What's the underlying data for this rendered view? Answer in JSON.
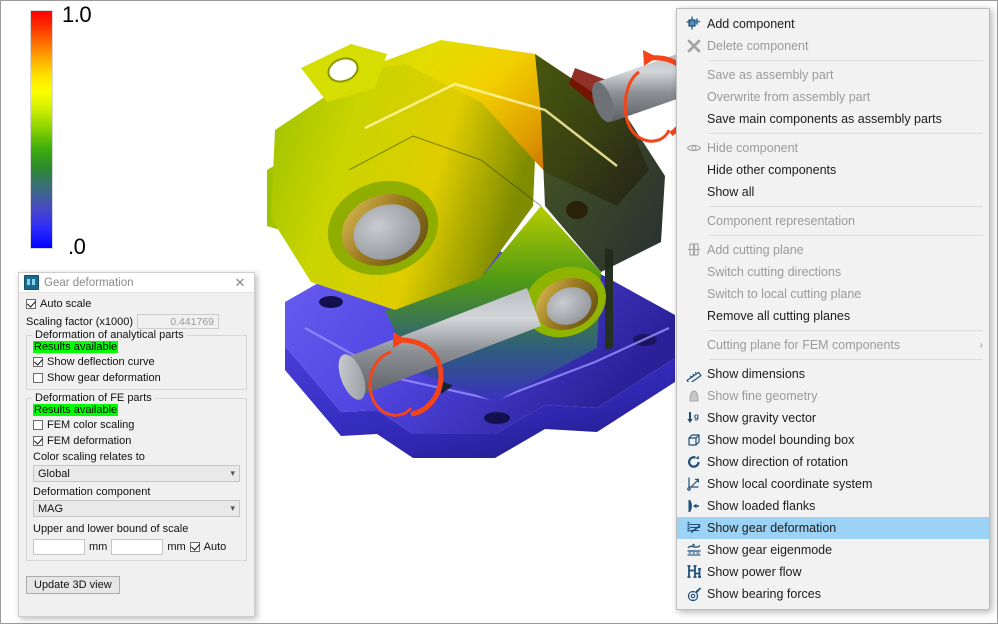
{
  "legend": {
    "max_label": "1.0",
    "min_label": ".0",
    "top_color": "#ff0000",
    "bottom_color": "#0000ff"
  },
  "model": {
    "description": "3D gearbox housing with FEM deformation colour map",
    "rotation_arrow_color": "#f5441a",
    "shaft_color": "#9b9ea3"
  },
  "dialog": {
    "title": "Gear deformation",
    "app_icon": "app-icon",
    "close_icon": "close-icon",
    "auto_scale": {
      "label": "Auto scale",
      "checked": true
    },
    "scaling_factor": {
      "label": "Scaling factor (x1000)",
      "value": "0.441769"
    },
    "analytical": {
      "group_title": "Deformation of analytical parts",
      "status": "Results available",
      "items": [
        {
          "label": "Show deflection curve",
          "checked": true
        },
        {
          "label": "Show gear deformation",
          "checked": false
        }
      ]
    },
    "fe": {
      "group_title": "Deformation of FE parts",
      "status": "Results available",
      "items": [
        {
          "label": "FEM color scaling",
          "checked": false
        },
        {
          "label": "FEM deformation",
          "checked": true
        }
      ],
      "color_scaling_label": "Color scaling relates to",
      "color_scaling_value": "Global",
      "deformation_component_label": "Deformation component",
      "deformation_component_value": "MAG",
      "bounds_label": "Upper and lower bound of scale",
      "bound_lower_value": "",
      "bound_upper_value": "",
      "unit": "mm",
      "auto_label": "Auto",
      "auto_checked": true
    },
    "update_button": "Update 3D view",
    "status_green": "#00ff00"
  },
  "context_menu": {
    "highlight_color": "#9bd2f5",
    "items": [
      {
        "label": "Add component",
        "icon": "add-component-icon",
        "enabled": true,
        "selected": false,
        "separator_after": false
      },
      {
        "label": "Delete component",
        "icon": "delete-component-icon",
        "enabled": false,
        "selected": false,
        "separator_after": true
      },
      {
        "label": "Save as assembly part",
        "icon": "",
        "enabled": false,
        "selected": false,
        "separator_after": false
      },
      {
        "label": "Overwrite from assembly part",
        "icon": "",
        "enabled": false,
        "selected": false,
        "separator_after": false
      },
      {
        "label": "Save main components as assembly parts",
        "icon": "",
        "enabled": true,
        "selected": false,
        "separator_after": true
      },
      {
        "label": "Hide component",
        "icon": "eye-icon",
        "enabled": false,
        "selected": false,
        "separator_after": false
      },
      {
        "label": "Hide other components",
        "icon": "",
        "enabled": true,
        "selected": false,
        "separator_after": false
      },
      {
        "label": "Show all",
        "icon": "",
        "enabled": true,
        "selected": false,
        "separator_after": true
      },
      {
        "label": "Component representation",
        "icon": "",
        "enabled": false,
        "selected": false,
        "separator_after": true
      },
      {
        "label": "Add cutting plane",
        "icon": "cutting-plane-icon",
        "enabled": false,
        "selected": false,
        "separator_after": false
      },
      {
        "label": "Switch cutting directions",
        "icon": "",
        "enabled": false,
        "selected": false,
        "separator_after": false
      },
      {
        "label": "Switch to local cutting plane",
        "icon": "",
        "enabled": false,
        "selected": false,
        "separator_after": false
      },
      {
        "label": "Remove all cutting planes",
        "icon": "",
        "enabled": true,
        "selected": false,
        "separator_after": true
      },
      {
        "label": "Cutting plane for FEM components",
        "icon": "",
        "enabled": false,
        "selected": false,
        "submenu": true,
        "separator_after": true
      },
      {
        "label": "Show dimensions",
        "icon": "ruler-icon",
        "enabled": true,
        "selected": false,
        "separator_after": false
      },
      {
        "label": "Show fine geometry",
        "icon": "fine-geometry-icon",
        "enabled": false,
        "selected": false,
        "separator_after": false
      },
      {
        "label": "Show gravity vector",
        "icon": "gravity-vector-icon",
        "enabled": true,
        "selected": false,
        "separator_after": false
      },
      {
        "label": "Show model bounding box",
        "icon": "bounding-box-icon",
        "enabled": true,
        "selected": false,
        "separator_after": false
      },
      {
        "label": "Show direction of rotation",
        "icon": "rotation-direction-icon",
        "enabled": true,
        "selected": false,
        "separator_after": false
      },
      {
        "label": "Show local coordinate system",
        "icon": "coordinate-system-icon",
        "enabled": true,
        "selected": false,
        "separator_after": false
      },
      {
        "label": "Show loaded flanks",
        "icon": "loaded-flanks-icon",
        "enabled": true,
        "selected": false,
        "separator_after": false
      },
      {
        "label": "Show gear deformation",
        "icon": "gear-deformation-icon",
        "enabled": true,
        "selected": true,
        "separator_after": false
      },
      {
        "label": "Show gear eigenmode",
        "icon": "gear-eigenmode-icon",
        "enabled": true,
        "selected": false,
        "separator_after": false
      },
      {
        "label": "Show power flow",
        "icon": "power-flow-icon",
        "enabled": true,
        "selected": false,
        "separator_after": false
      },
      {
        "label": "Show bearing forces",
        "icon": "bearing-forces-icon",
        "enabled": true,
        "selected": false,
        "separator_after": false
      }
    ],
    "submenu_arrow": "›"
  }
}
